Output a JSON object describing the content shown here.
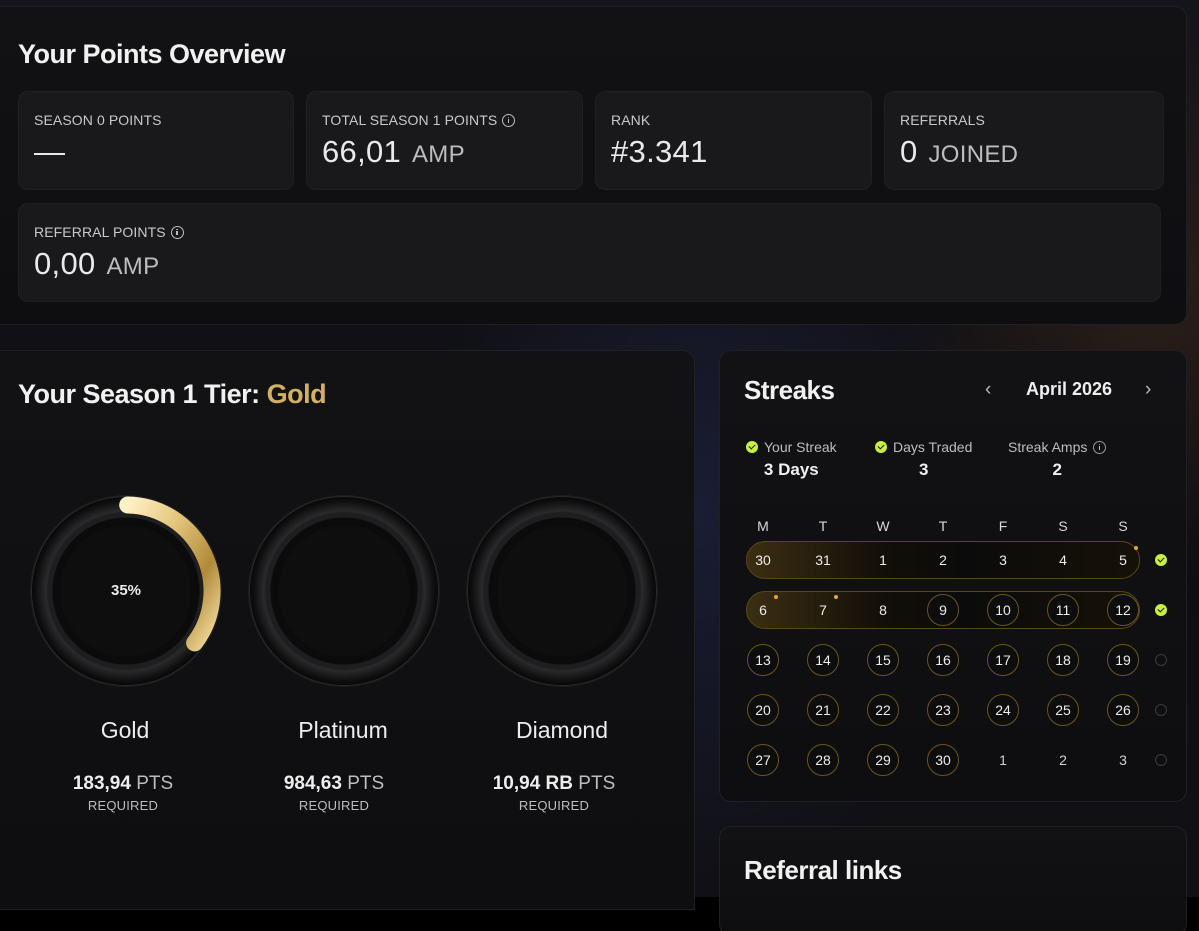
{
  "overview": {
    "title": "Your Points Overview",
    "cards": [
      {
        "label": "SEASON 0 POINTS",
        "value": "—",
        "unit": "",
        "info": false
      },
      {
        "label": "TOTAL SEASON 1 POINTS",
        "value": "66,01",
        "unit": "AMP",
        "info": true
      },
      {
        "label": "RANK",
        "value": "#3.341",
        "unit": "",
        "info": false
      },
      {
        "label": "REFERRALS",
        "value": "0",
        "unit": "JOINED",
        "info": false
      }
    ],
    "referral_points": {
      "label": "REFERRAL POINTS",
      "value": "0,00",
      "unit": "AMP",
      "info": true
    }
  },
  "tier": {
    "title_prefix": "Your Season 1 Tier:",
    "current": "Gold",
    "accent_color": "#d4b162",
    "tiers": [
      {
        "name": "Gold",
        "progress_label": "35%",
        "progress": 0.35,
        "pts_value": "183,94",
        "pts_unit": "PTS",
        "req": "REQUIRED"
      },
      {
        "name": "Platinum",
        "progress_label": "",
        "progress": 0,
        "pts_value": "984,63",
        "pts_unit": "PTS",
        "req": "REQUIRED"
      },
      {
        "name": "Diamond",
        "progress_label": "",
        "progress": 0,
        "pts_value": "10,94 RB",
        "pts_unit": "PTS",
        "req": "REQUIRED"
      }
    ]
  },
  "streaks": {
    "title": "Streaks",
    "month": "April 2026",
    "prev_icon": "chevron-left-icon",
    "next_icon": "chevron-right-icon",
    "stats": [
      {
        "label": "Your Streak",
        "value": "3 Days",
        "check": true,
        "info": false
      },
      {
        "label": "Days Traded",
        "value": "3",
        "check": true,
        "info": false
      },
      {
        "label": "Streak Amps",
        "value": "2",
        "check": false,
        "info": true
      }
    ],
    "weekdays": [
      "M",
      "T",
      "W",
      "T",
      "F",
      "S",
      "S"
    ],
    "weeks": [
      {
        "days": [
          "30",
          "31",
          "1",
          "2",
          "3",
          "4",
          "5"
        ],
        "completed": true
      },
      {
        "days": [
          "6",
          "7",
          "8",
          "9",
          "10",
          "11",
          "12"
        ],
        "completed": true
      },
      {
        "days": [
          "13",
          "14",
          "15",
          "16",
          "17",
          "18",
          "19"
        ],
        "completed": false
      },
      {
        "days": [
          "20",
          "21",
          "22",
          "23",
          "24",
          "25",
          "26"
        ],
        "completed": false
      },
      {
        "days": [
          "27",
          "28",
          "29",
          "30",
          "1",
          "2",
          "3"
        ],
        "completed": false
      }
    ],
    "accent_color": "#c8f03c"
  },
  "referral_links": {
    "title": "Referral links"
  }
}
